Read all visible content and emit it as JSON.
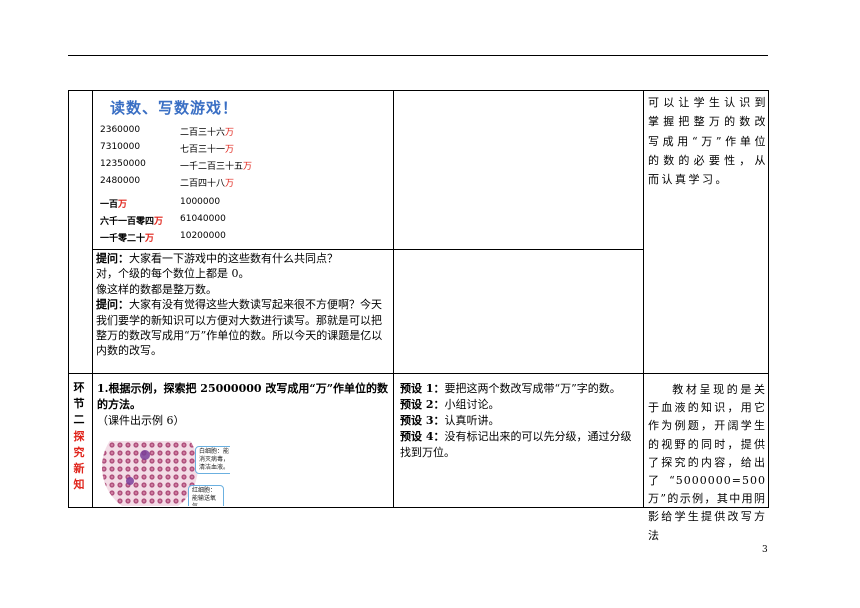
{
  "game": {
    "title": "读数、写数游戏！",
    "pairs": [
      {
        "number": "2360000",
        "words": "二百三十六",
        "wan": "万"
      },
      {
        "number": "7310000",
        "words": "七百三十一",
        "wan": "万"
      },
      {
        "number": "12350000",
        "words": "一千二百三十五",
        "wan": "万"
      },
      {
        "number": "2480000",
        "words": "二百四十八",
        "wan": "万"
      }
    ],
    "pairs2": [
      {
        "words": "一百",
        "wan": "万",
        "number": "1000000"
      },
      {
        "words": "六千一百零四",
        "wan": "万",
        "number": "61040000"
      },
      {
        "words": "一千零二十",
        "wan": "万",
        "number": "10200000"
      }
    ]
  },
  "question": {
    "label1": "提问：",
    "text1": "大家看一下游戏中的这些数有什么共同点？",
    "line2": "对，个级的每个数位上都是 0。",
    "line3": "像这样的数都是整万数。",
    "label2": "提问：",
    "text2": "大家有没有觉得这些大数读写起来很不方便啊？今天我们要学的新知识可以方便对大数进行读写。那就是可以把整万的数改写成用“万”作单位的数。所以今天的课题是亿以内数的改写。"
  },
  "note1": "可以让学生认识到掌握把整万的数改写成用“万”作单位的数的必要性，从而认真学习。",
  "section2": {
    "label_black": "环节二",
    "label_red": "探究新知",
    "heading": "1.根据示例，探索把 25000000 改写成用“万”作单位的数的方法。",
    "sub": "（课件出示例 6）",
    "callout_white": "白细胞：能消灭病毒，清洁血液。",
    "callout_red": "红细胞：能输送氧气。",
    "presets": [
      {
        "label": "预设 1：",
        "text": "要把这两个数改写成带“万”字的数。"
      },
      {
        "label": "预设 2：",
        "text": "小组讨论。"
      },
      {
        "label": "预设 3：",
        "text": "认真听讲。"
      },
      {
        "label": "预设 4：",
        "text": "没有标记出来的可以先分级，通过分级找到万位。"
      }
    ],
    "note2": "教材呈现的是关于血液的知识，用它作为例题，开阔学生的视野的同时，提供了探究的内容，给出了“5000000=500 万”的示例，其中用阴影给学生提供改写方法"
  },
  "page_number": "3"
}
